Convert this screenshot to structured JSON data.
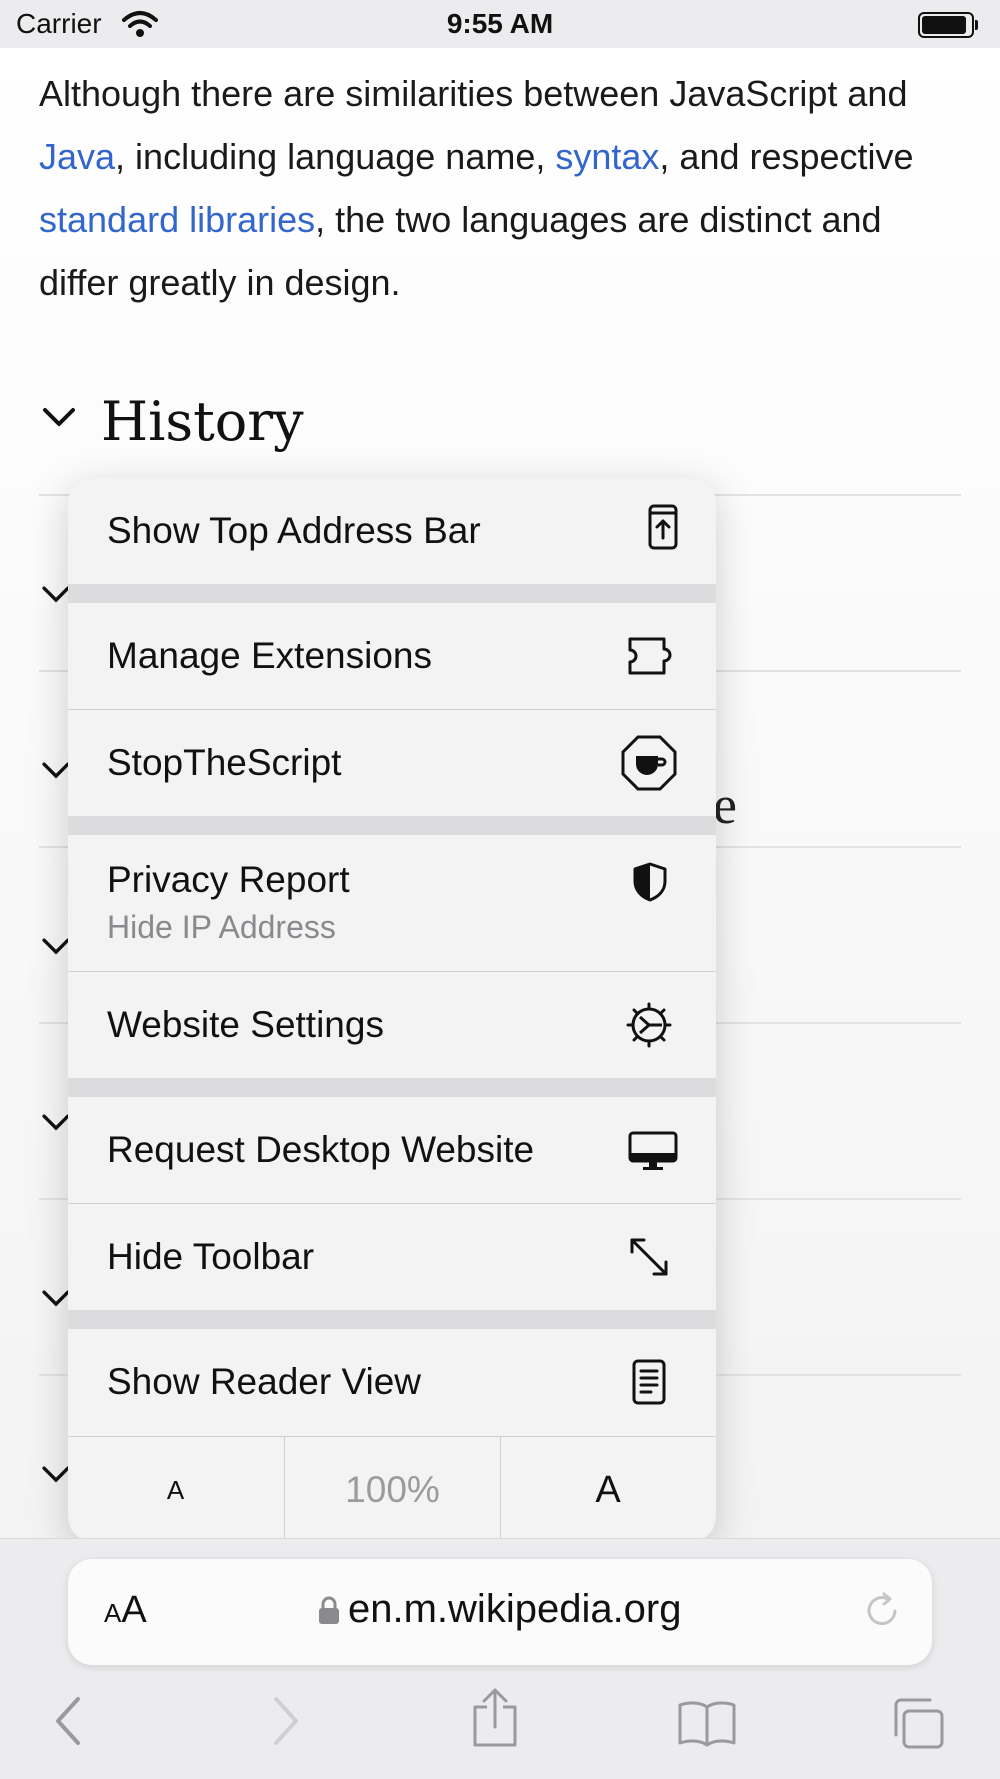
{
  "status_bar": {
    "carrier": "Carrier",
    "time": "9:55 AM"
  },
  "article": {
    "p_before_java": "Although there are similarities between JavaScript and ",
    "link_java": "Java",
    "p_after_java": ", including language name, ",
    "link_syntax": "syntax",
    "p_after_syntax": ", and respective ",
    "link_stdlib": "standard libraries",
    "p_end": ", the two languages are distinct and differ greatly in design.",
    "section_history": "History",
    "stray_char": "e"
  },
  "menu": {
    "show_top_address_bar": "Show Top Address Bar",
    "manage_extensions": "Manage Extensions",
    "stopthescript": "StopTheScript",
    "privacy_report": "Privacy Report",
    "privacy_report_sub": "Hide IP Address",
    "website_settings": "Website Settings",
    "request_desktop": "Request Desktop Website",
    "hide_toolbar": "Hide Toolbar",
    "show_reader_view": "Show Reader View",
    "zoom_small": "A",
    "zoom_level": "100%",
    "zoom_large": "A"
  },
  "address_bar": {
    "aa_small": "A",
    "aa_large": "A",
    "url": "en.m.wikipedia.org"
  },
  "icons": {
    "menu": [
      "phone-arrow-up-icon",
      "puzzle-icon",
      "stop-octagon-cup-icon",
      "shield-icon",
      "gear-icon",
      "desktop-icon",
      "expand-arrows-icon",
      "reader-doc-icon"
    ],
    "toolbar": [
      "back-icon",
      "forward-icon",
      "share-icon",
      "bookmarks-icon",
      "tabs-icon"
    ]
  },
  "colors": {
    "link": "#3366cc",
    "menu_bg": "#f3f3f3",
    "separator_band": "#dcdcde",
    "secondary_text": "#8a8a8e"
  }
}
